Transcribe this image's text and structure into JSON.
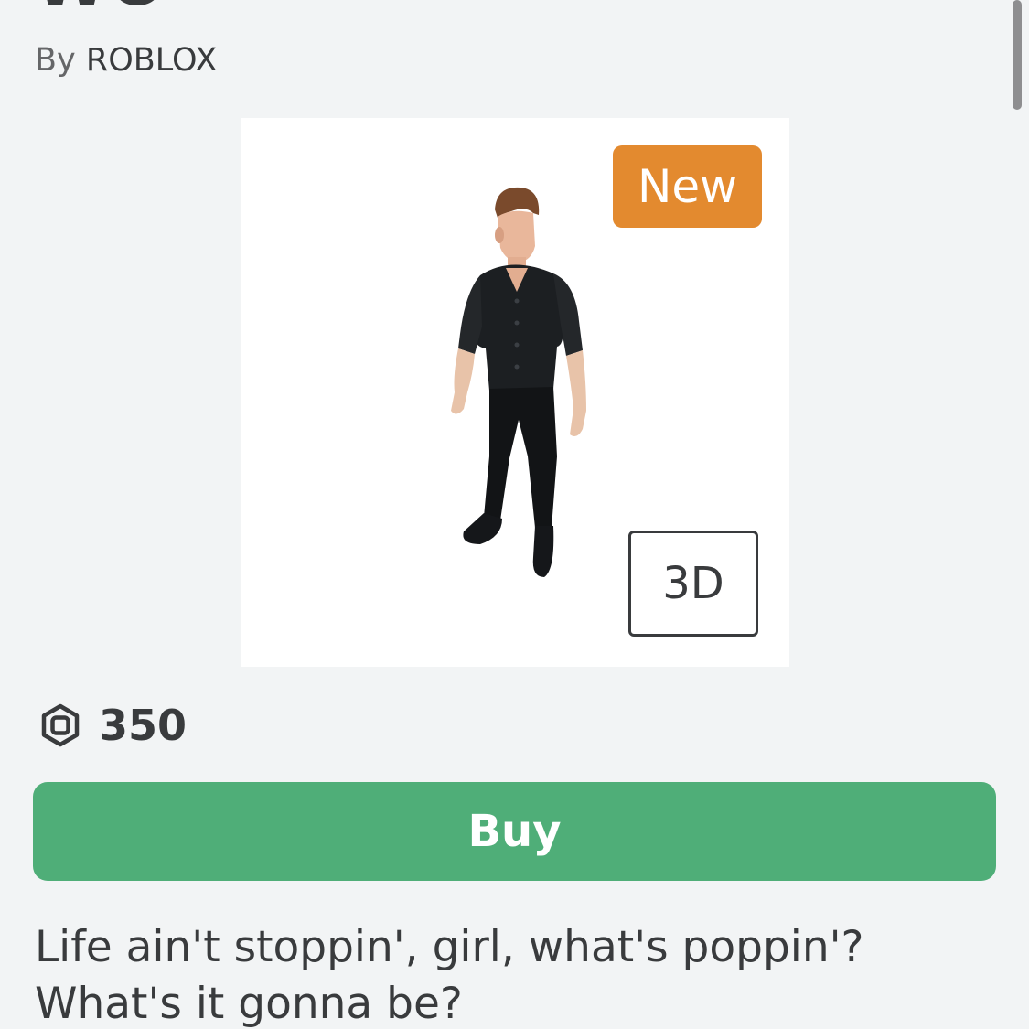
{
  "item": {
    "title": "WO",
    "creator_prefix": "By",
    "creator_name": "ROBLOX",
    "badge_new": "New",
    "view_3d_label": "3D",
    "price": "350",
    "buy_label": "Buy",
    "description_lines": [
      "Life ain't stoppin', girl, what's poppin'?",
      "What's it gonna be?"
    ]
  },
  "icons": {
    "currency": "robux-icon",
    "avatar": "avatar-thumbnail"
  },
  "colors": {
    "background": "#f2f4f5",
    "new_badge": "#e38a2f",
    "buy_button": "#4fae78",
    "text_primary": "#393b3d",
    "text_secondary": "#656668"
  }
}
